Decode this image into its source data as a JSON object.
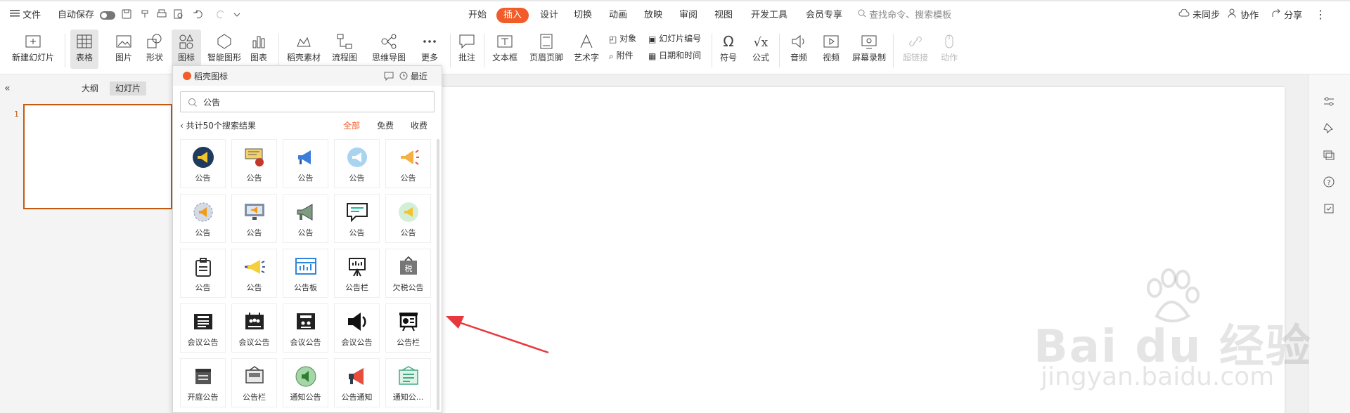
{
  "menubar": {
    "file": "文件",
    "autosave": "自动保存",
    "tabs": [
      "开始",
      "插入",
      "设计",
      "切换",
      "动画",
      "放映",
      "审阅",
      "视图",
      "开发工具",
      "会员专享"
    ],
    "active_tab": "插入",
    "search_placeholder": "查找命令、搜索模板",
    "sync": "未同步",
    "collab": "协作",
    "share": "分享"
  },
  "ribbon": {
    "new_slide": "新建幻灯片",
    "table": "表格",
    "picture": "图片",
    "shape": "形状",
    "icon": "图标",
    "smart_shape": "智能图形",
    "chart": "图表",
    "assets": "稻壳素材",
    "flowchart": "流程图",
    "mindmap": "思维导图",
    "more": "更多",
    "comment": "批注",
    "textbox": "文本框",
    "header_footer": "页眉页脚",
    "wordart": "艺术字",
    "object": "对象",
    "attachment": "附件",
    "slide_number": "幻灯片编号",
    "datetime": "日期和时间",
    "symbol": "符号",
    "formula": "公式",
    "audio": "音频",
    "video": "视频",
    "screen_record": "屏幕录制",
    "hyperlink": "超链接",
    "action": "动作"
  },
  "leftpane": {
    "outline": "大纲",
    "slides": "幻灯片",
    "slide_number": "1"
  },
  "panel": {
    "title": "稻壳图标",
    "recent": "最近",
    "search_value": "公告",
    "result_count": "共计50个搜索结果",
    "filters": [
      "全部",
      "免费",
      "收费"
    ],
    "active_filter": "全部",
    "icons": [
      {
        "label": "公告",
        "icon": "megaphone-circle-icon"
      },
      {
        "label": "公告",
        "icon": "announcement-board-icon"
      },
      {
        "label": "公告",
        "icon": "megaphone-blue-icon"
      },
      {
        "label": "公告",
        "icon": "megaphone-globe-icon"
      },
      {
        "label": "公告",
        "icon": "megaphone-orange-icon"
      },
      {
        "label": "公告",
        "icon": "megaphone-gear-icon"
      },
      {
        "label": "公告",
        "icon": "monitor-speaker-icon"
      },
      {
        "label": "公告",
        "icon": "megaphone-green-icon"
      },
      {
        "label": "公告",
        "icon": "chat-lines-icon"
      },
      {
        "label": "公告",
        "icon": "megaphone-bubble-icon"
      },
      {
        "label": "公告",
        "icon": "clipboard-outline-icon"
      },
      {
        "label": "公告",
        "icon": "megaphone-yellow-icon"
      },
      {
        "label": "公告板",
        "icon": "bulletin-board-icon"
      },
      {
        "label": "公告栏",
        "icon": "easel-icon"
      },
      {
        "label": "欠税公告",
        "icon": "tax-notice-icon"
      },
      {
        "label": "会议公告",
        "icon": "meeting-notice-icon"
      },
      {
        "label": "会议公告",
        "icon": "meeting-people-icon"
      },
      {
        "label": "会议公告",
        "icon": "meeting-sign-icon"
      },
      {
        "label": "会议公告",
        "icon": "speaker-icon"
      },
      {
        "label": "公告栏",
        "icon": "presentation-board-icon"
      },
      {
        "label": "开庭公告",
        "icon": "court-notice-icon"
      },
      {
        "label": "公告栏",
        "icon": "hanging-sign-icon"
      },
      {
        "label": "通知公告",
        "icon": "speaker-circle-icon"
      },
      {
        "label": "公告通知",
        "icon": "megaphone-red-icon"
      },
      {
        "label": "通知公...",
        "icon": "notice-card-icon"
      }
    ]
  },
  "watermark": {
    "text": "Bai du 经验",
    "url": "jingyan.baidu.com"
  },
  "colors": {
    "accent": "#f25c2a",
    "thumb_border": "#c55a11",
    "arrow": "#e8383d"
  }
}
